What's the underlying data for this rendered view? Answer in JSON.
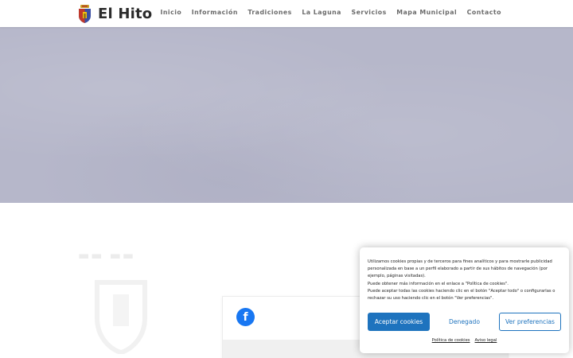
{
  "header": {
    "logo_text": "El Hito",
    "nav": [
      {
        "label": "Inicio"
      },
      {
        "label": "Información"
      },
      {
        "label": "Tradiciones"
      },
      {
        "label": "La Laguna"
      },
      {
        "label": "Servicios"
      },
      {
        "label": "Mapa Municipal"
      },
      {
        "label": "Contacto"
      }
    ]
  },
  "colors": {
    "hero_overlay": "#b6b7ca",
    "accent": "#1e73be",
    "facebook": "#1877f2"
  },
  "social": {
    "icon": "facebook-icon",
    "letter": "f"
  },
  "cookie_banner": {
    "lines": [
      "Utilizamos cookies propias y de terceros para fines analíticos y para mostrarle publicidad personalizada en base a un perfil elaborado a partir de sus hábitos de navegación (por ejemplo, páginas visitadas).",
      "Puede obtener más información en el enlace a \"Política de cookies\".",
      "Puede aceptar todas las cookies haciendo clic en el botón \"Aceptar todo\" o configurarlas o rechazar su uso haciendo clic en el botón \"Ver preferencias\"."
    ],
    "accept_label": "Aceptar cookies",
    "deny_label": "Denegado",
    "prefs_label": "Ver preferencias",
    "policy_link": "Política de cookies",
    "legal_link": "Aviso legal"
  }
}
